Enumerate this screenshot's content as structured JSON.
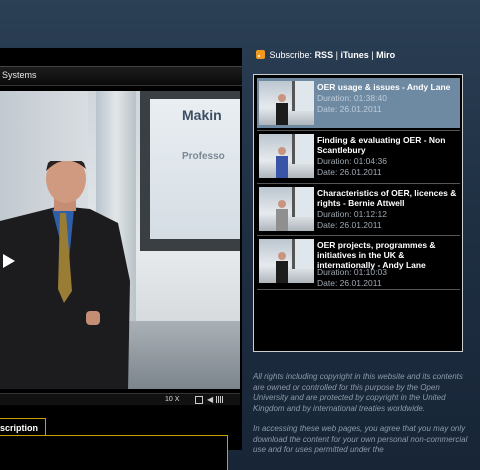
{
  "video_panel": {
    "title": "Systems",
    "slide_title": "Makin",
    "slide_subtitle": "Professo",
    "controls": {
      "zoom": "10 X"
    },
    "transcript_tab": "scription"
  },
  "subscribe": {
    "label": "Subscribe:",
    "rss": "RSS",
    "itunes": "iTunes",
    "miro": "Miro",
    "separator": "|"
  },
  "playlist": [
    {
      "title": "OER usage & issues - Andy Lane",
      "duration": "Duration: 01:38:40",
      "date": "Date: 26.01.2011",
      "active": true
    },
    {
      "title": "Finding & evaluating OER - Non Scantlebury",
      "duration": "Duration: 01:04:36",
      "date": "Date: 26.01.2011",
      "active": false
    },
    {
      "title": "Characteristics of OER, licences & rights - Bernie Attwell",
      "duration": "Duration: 01:12:12",
      "date": "Date: 26.01.2011",
      "active": false
    },
    {
      "title": "OER projects, programmes & initiatives in the UK & internationally - Andy Lane",
      "duration": "Duration: 01:10:03",
      "date": "Date: 26.01.2011",
      "active": false
    }
  ],
  "rights": {
    "p1": "All rights including copyright in this website and its contents are owned or controlled for this purpose by the Open University and are protected by copyright in the United Kingdom and by international treaties worldwide.",
    "p2": "In accessing these web pages, you agree that you may only download the content for your own personal non-commercial use and for uses permitted under the"
  },
  "colors": {
    "accent_gold": "#c8a000",
    "active_item": "#6e8aa3",
    "rss_orange": "#f29a1f"
  }
}
